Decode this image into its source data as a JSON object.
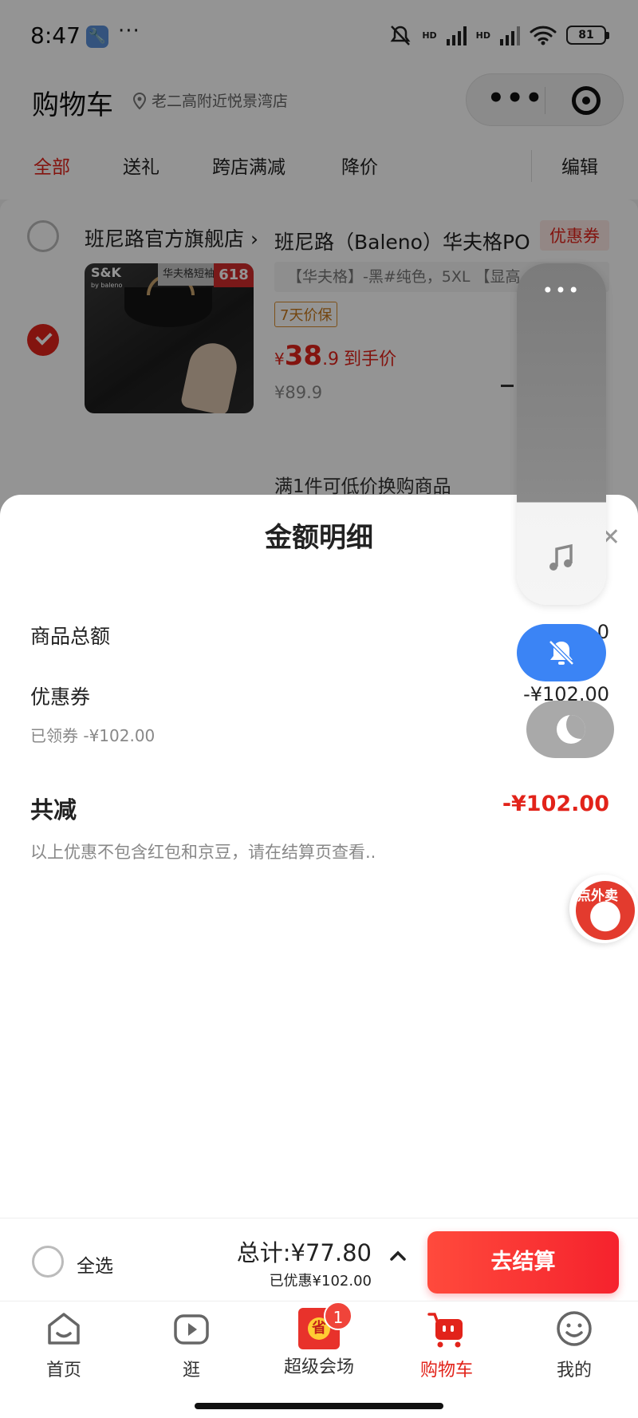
{
  "status_bar": {
    "time": "8:47",
    "battery": "81",
    "signal_label": "HD"
  },
  "header": {
    "title": "购物车",
    "location": "老二高附近悦景湾店"
  },
  "tabs": [
    {
      "label": "全部"
    },
    {
      "label": "送礼"
    },
    {
      "label": "跨店满减"
    },
    {
      "label": "降价"
    }
  ],
  "edit_label": "编辑",
  "store": {
    "name": "班尼路官方旗舰店",
    "coupon_tag": "优惠券",
    "product": {
      "title": "班尼路（Baleno）华夫格PO",
      "spec": "【华夫格】-黑#纯色，5XL 【显高",
      "guarantee": "7天价保",
      "price_currency": "¥",
      "price_int": "38",
      "price_dec": ".9",
      "price_label": "到手价",
      "original_price": "¥89.9",
      "image_brand": "S&K",
      "image_brand_sub": "by baleno",
      "image_banner": "华夫格短袖",
      "image_badge": "618"
    },
    "promo": "满1件可低价换购商品"
  },
  "sheet": {
    "title": "金额明细",
    "rows": [
      {
        "label": "商品总额",
        "amount": "0"
      },
      {
        "label": "优惠券",
        "amount": "-¥102.00",
        "sub": "已领券 -¥102.00"
      }
    ],
    "total_label": "共减",
    "total_amount": "-¥102.00",
    "note": "以上优惠不包含红包和京豆，请在结算页查看.."
  },
  "float_widget": {
    "dots": "•••"
  },
  "waimai": {
    "label": "点外卖"
  },
  "checkout": {
    "select_all": "全选",
    "total": "总计:¥77.80",
    "saved": "已优惠¥102.00",
    "button": "去结算"
  },
  "tabbar": [
    {
      "label": "首页",
      "icon": "home-icon"
    },
    {
      "label": "逛",
      "icon": "video-icon"
    },
    {
      "label": "超级会场",
      "icon": "venue-icon",
      "badge": "1"
    },
    {
      "label": "购物车",
      "icon": "cart-icon",
      "active": true
    },
    {
      "label": "我的",
      "icon": "profile-icon"
    }
  ],
  "colors": {
    "accent": "#e2231a",
    "blue": "#3b84f5",
    "coupon_bg": "#fde8e6"
  }
}
